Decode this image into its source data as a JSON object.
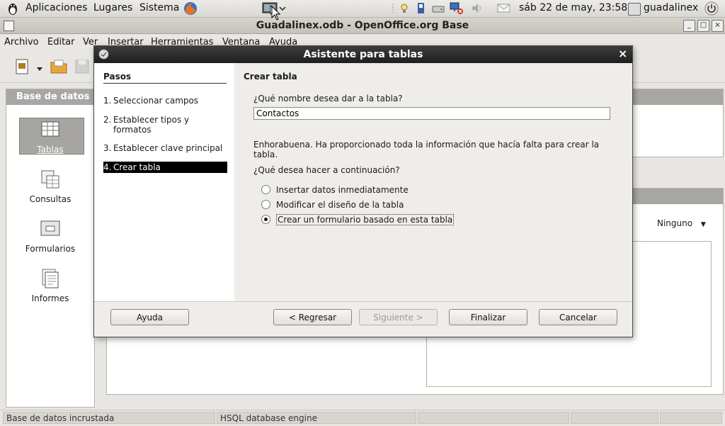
{
  "top_panel": {
    "menus": [
      "Aplicaciones",
      "Lugares",
      "Sistema"
    ],
    "clock": "sáb 22 de may, 23:58",
    "user": "guadalinex"
  },
  "window": {
    "title": "Guadalinex.odb - OpenOffice.org Base",
    "menubar": [
      "Archivo",
      "Editar",
      "Ver",
      "Insertar",
      "Herramientas",
      "Ventana",
      "Ayuda"
    ]
  },
  "left_panel": {
    "title": "Base de datos",
    "items": [
      {
        "label": "Tablas",
        "selected": true
      },
      {
        "label": "Consultas",
        "selected": false
      },
      {
        "label": "Formularios",
        "selected": false
      },
      {
        "label": "Informes",
        "selected": false
      }
    ]
  },
  "preview": {
    "selected": "Ninguno"
  },
  "statusbar": [
    "Base de datos incrustada",
    "HSQL database engine",
    "",
    "",
    ""
  ],
  "dialog": {
    "title": "Asistente para tablas",
    "steps_header": "Pasos",
    "steps": [
      {
        "num": "1.",
        "label": "Seleccionar campos",
        "active": false
      },
      {
        "num": "2.",
        "label": "Establecer tipos y formatos",
        "active": false
      },
      {
        "num": "3.",
        "label": "Establecer clave principal",
        "active": false
      },
      {
        "num": "4.",
        "label": "Crear tabla",
        "active": true
      }
    ],
    "content_header": "Crear tabla",
    "name_question": "¿Qué nombre desea dar a la tabla?",
    "name_value": "Contactos",
    "congrats": "Enhorabuena. Ha proporcionado toda la información que hacía falta para crear la tabla.",
    "next_question": "¿Qué desea hacer a continuación?",
    "options": [
      {
        "label": "Insertar datos inmediatamente",
        "checked": false
      },
      {
        "label": "Modificar el diseño de la tabla",
        "checked": false
      },
      {
        "label": "Crear un formulario basado en esta tabla",
        "checked": true
      }
    ],
    "buttons": {
      "help": "Ayuda",
      "back": "< Regresar",
      "next": "Siguiente >",
      "finish": "Finalizar",
      "cancel": "Cancelar"
    }
  }
}
